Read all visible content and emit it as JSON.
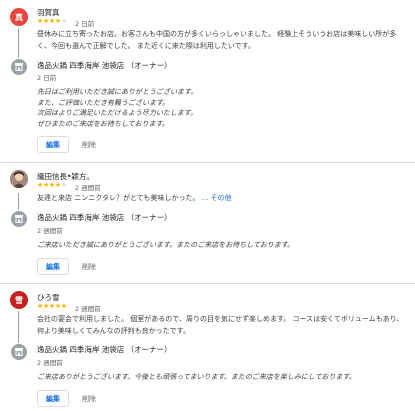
{
  "colors": {
    "accent": "#1a73e8",
    "star": "#f4b400",
    "divider": "#dadce0",
    "avatar1": "#e8453c",
    "avatar3": "#c5221f"
  },
  "reviews": [
    {
      "avatar_letter": "真",
      "name": "羽賀真",
      "stars": "★★★★",
      "stars_off": "★",
      "rating": 4,
      "date": "2 日前",
      "text": "昼休みに立ち寄ったお店。お客さんも中国の方が多くいらっしゃいました。 経験上そういうお店は美味しい所が多く、今回も選んで正解でした。 また近くに来た際は利用したいです。",
      "owner_name": "逸品火鍋 四季海岸 池袋店 （オーナー）",
      "owner_date": "2 日前",
      "reply_lines": [
        "先日はご利用いただき誠にありがとうございます。",
        "また、ご評価いただき有難うございます。",
        "次回はよりご満足いただけるよう尽力いたします。",
        "ぜひまたのご来店をお待ちしております。"
      ],
      "edit_label": "編集",
      "delete_label": "削除"
    },
    {
      "name": "織田信長•颖方。",
      "stars": "★★★★",
      "stars_off": "★",
      "rating": 4,
      "date": "2 週間前",
      "text": "友達と来店 ニンニクタレ？がとても美味しかった。",
      "more_label": "... その他",
      "owner_name": "逸品火鍋 四季海岸 池袋店 （オーナー）",
      "owner_date": "2 週間前",
      "reply": "ご来店いただき誠にありがとうございます。またのご来店をお待ちしております。",
      "edit_label": "編集",
      "delete_label": "削除"
    },
    {
      "avatar_letter": "雪",
      "name": "ひろ雪",
      "stars": "★★★★★",
      "rating": 5,
      "date": "2 週間前",
      "text": "会社の宴会で利用しました。 個室があるので、周りの目を気にせず楽しめます。 コースは安くてボリュームもあり、何より美味しくてみんなの評判も良かったです。",
      "owner_name": "逸品火鍋 四季海岸 池袋店 （オーナー）",
      "owner_date": "2 週間前",
      "reply": "ご来店ありがとうございます。今後とも頑張ってまいります。またのご来店を楽しみにしております。",
      "edit_label": "編集",
      "delete_label": "削除"
    }
  ]
}
